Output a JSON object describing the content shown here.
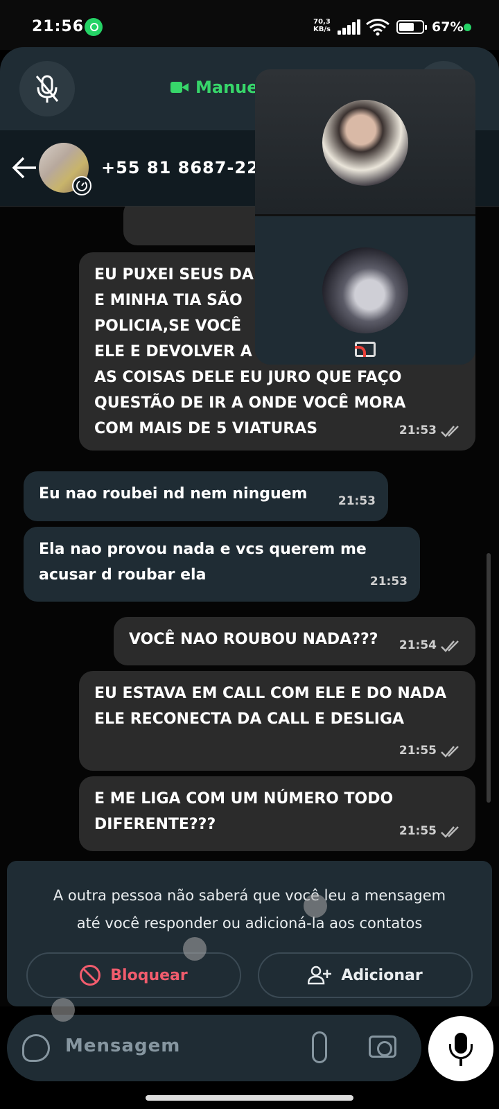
{
  "status_bar": {
    "time": "21:56",
    "net_speed_value": "70,3",
    "net_speed_unit": "KB/s",
    "battery_percent": "67%",
    "battery_level": 0.67,
    "accent_color": "#25d366"
  },
  "call_banner": {
    "title": "Manuel",
    "mute_icon": "mic-off-icon",
    "call_icon": "video-camera-icon",
    "title_color": "#37d66a"
  },
  "header": {
    "contact": "+55 81 8687-22",
    "back_icon": "arrow-left-icon",
    "avatar_badge_icon": "timer-icon"
  },
  "messages": [
    {
      "direction": "out",
      "text": "EU PUXEI SEUS DA\nE MINHA TIA SÃO\nPOLICIA,SE VOCÊ\nELE E DEVOLVER A\nAS COISAS DELE EU JURO QUE FAÇO\nQUESTÃO DE IR A ONDE VOCÊ MORA\nCOM MAIS DE 5 VIATURAS",
      "time": "21:53"
    },
    {
      "direction": "in",
      "text": "Eu nao roubei nd nem ninguem",
      "time": "21:53"
    },
    {
      "direction": "in",
      "text": "Ela nao provou nada e vcs querem me\nacusar d roubar ela",
      "time": "21:53"
    },
    {
      "direction": "out",
      "text": "VOCÊ NAO ROUBOU NADA???",
      "time": "21:54"
    },
    {
      "direction": "out",
      "text": "EU ESTAVA EM CALL COM ELE E DO NADA\nELE RECONECTA DA CALL E DESLIGA",
      "time": "21:55"
    },
    {
      "direction": "out",
      "text": "E ME LIGA COM UM NÚMERO TODO\nDIFERENTE???",
      "time": "21:55"
    }
  ],
  "pip": {
    "cast_icon": "screen-cast-icon"
  },
  "unknown_contact": {
    "notice": "A outra pessoa não saberá que você leu a mensagem\naté você responder ou adicioná-la aos contatos",
    "block_label": "Bloquear",
    "add_label": "Adicionar",
    "block_color": "#f15c6d"
  },
  "composer": {
    "placeholder": "Mensagem",
    "sticker_icon": "sticker-icon",
    "attach_icon": "paperclip-icon",
    "camera_icon": "camera-icon",
    "mic_icon": "microphone-icon"
  }
}
